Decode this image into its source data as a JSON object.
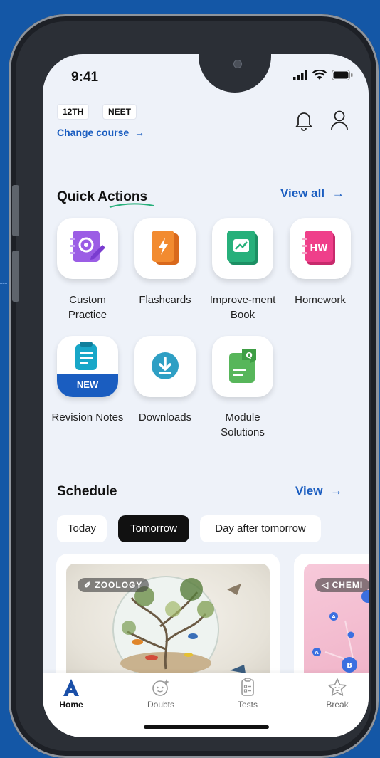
{
  "status_bar": {
    "time": "9:41"
  },
  "course": {
    "chips": [
      "12TH",
      "NEET"
    ],
    "change_label": "Change course",
    "change_arrow": "→"
  },
  "quick_actions": {
    "title": "Quick Actions",
    "view_all_label": "View all",
    "link_arrow": "→",
    "items": [
      {
        "label": "Custom Practice",
        "icon": "target-icon",
        "color": "#9b5de5"
      },
      {
        "label": "Flashcards",
        "icon": "flashcard-icon",
        "color": "#f28b30"
      },
      {
        "label": "Improve-ment Book",
        "icon": "trend-icon",
        "color": "#27b07b"
      },
      {
        "label": "Homework",
        "icon": "homework-icon",
        "color": "#ef3f8a"
      },
      {
        "label": "Revision Notes",
        "icon": "notes-icon",
        "color": "#18a7c8",
        "badge": "NEW"
      },
      {
        "label": "Downloads",
        "icon": "download-icon",
        "color": "#2e9fc4"
      },
      {
        "label": "Module Solutions",
        "icon": "module-icon",
        "color": "#57b65a"
      }
    ]
  },
  "schedule": {
    "title": "Schedule",
    "view_label": "View",
    "link_arrow": "→",
    "tabs": [
      {
        "label": "Today",
        "active": false
      },
      {
        "label": "Tomorrow",
        "active": true
      },
      {
        "label": "Day after tomorrow",
        "active": false
      }
    ],
    "cards": [
      {
        "tag": "ZOOLOGY"
      },
      {
        "tag": "CHEMI"
      }
    ],
    "molecule_labels": [
      "A",
      "A",
      "B"
    ]
  },
  "bottom_nav": [
    {
      "label": "Home",
      "icon": "home-icon",
      "active": true
    },
    {
      "label": "Doubts",
      "icon": "doubts-icon",
      "active": false
    },
    {
      "label": "Tests",
      "icon": "tests-icon",
      "active": false
    },
    {
      "label": "Break",
      "icon": "break-icon",
      "active": false
    }
  ],
  "colors": {
    "background": "#1457a6",
    "accent": "#1a5dc0",
    "screen": "#eef2f9"
  }
}
